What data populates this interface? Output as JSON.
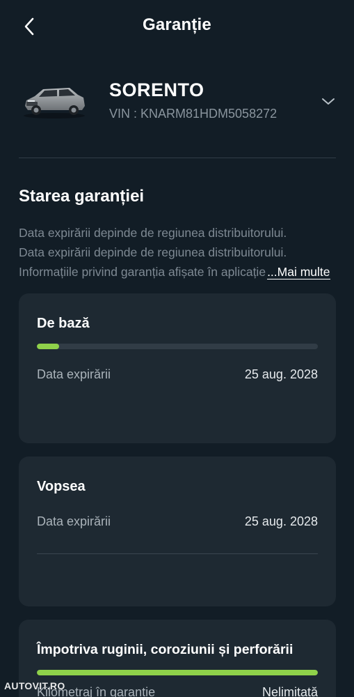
{
  "header": {
    "title": "Garanție",
    "back_icon": "chevron-left-icon"
  },
  "vehicle": {
    "name": "SORENTO",
    "vin_label": "VIN : ",
    "vin": "KNARM81HDM5058272",
    "dropdown_icon": "chevron-down-icon"
  },
  "warranty_status": {
    "title": "Starea garanției",
    "description_lines": [
      "Data expirării depinde de regiunea distribuitorului.",
      "Data expirării depinde de regiunea distribuitorului.",
      "Informațiile privind garanția afișate în aplicație"
    ],
    "more_link": "...Mai multe"
  },
  "cards": [
    {
      "title": "De bază",
      "progress": 0.08,
      "rows": [
        {
          "label": "Data expirării",
          "value": "25 aug. 2028"
        }
      ]
    },
    {
      "title": "Vopsea",
      "rows": [
        {
          "label": "Data expirării",
          "value": "25 aug. 2028"
        }
      ]
    },
    {
      "title": "Împotriva ruginii, coroziunii și perforării",
      "progress": 1.0,
      "rows": [
        {
          "label": "Kilometraj în garanție",
          "value": "Nelimitată"
        }
      ]
    }
  ],
  "watermark": "AUTOVIT.RO",
  "colors": {
    "background": "#121d26",
    "card": "#1e2932",
    "progress": "#8fd14a",
    "track": "#313c46",
    "muted_text": "#7e8993"
  }
}
